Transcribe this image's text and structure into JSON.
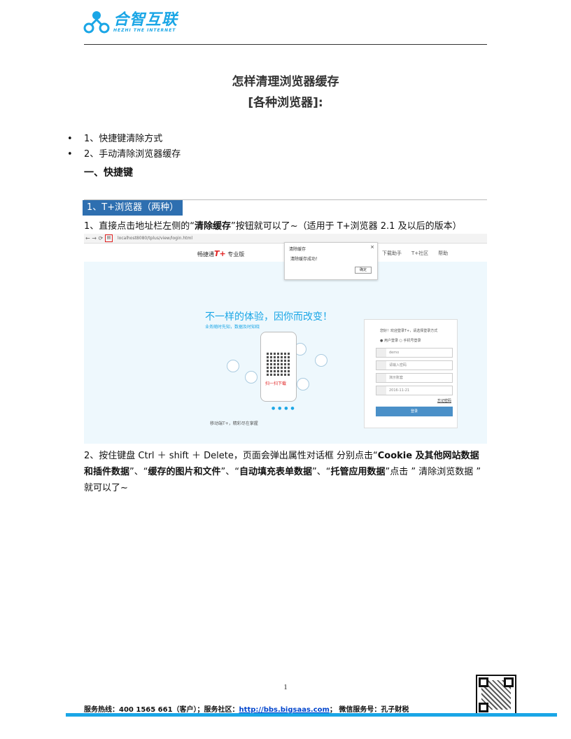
{
  "header": {
    "logo_cn": "合智互联",
    "logo_en": "HEZHI THE INTERNET"
  },
  "title": {
    "line1": "怎样清理浏览器缓存",
    "line2": "[各种浏览器]:"
  },
  "bullets": [
    "1、快捷键清除方式",
    "2、手动清除浏览器缓存"
  ],
  "section_heading": "一、快捷键",
  "subsection_tag": "1、T+浏览器（两种）",
  "para1": {
    "pre": "1、直接点击地址栏左侧的“",
    "bold": "清除缓存",
    "post": "”按钮就可以了~（适用于 T+浏览器 2.1 及以后的版本）"
  },
  "screenshot": {
    "url": "localhost8080/tplus/view/login.html",
    "brand": "畅捷通",
    "brand_tp": "T+",
    "brand_suffix": "专业版",
    "top_links": [
      "下载助手",
      "T+社区",
      "帮助"
    ],
    "dialog_title": "清除缓存",
    "dialog_msg": "清除缓存成功！",
    "dialog_ok": "确定",
    "slogan": "不一样的体验，因你而改变！",
    "slogan_sub": "业务随时先知，数据及时知晓",
    "phone_caption": "扫一扫下载",
    "bottom_text": "移动端T+，精彩尽在掌握",
    "login_question": "您好！欢迎登录T+，请选择登录方式",
    "login_radio": "● 用户登录    ○ 手机号登录",
    "login_fields": [
      "demo",
      "请输入密码",
      "演示账套",
      "2016-11-21"
    ],
    "login_forgot": "忘记密码",
    "login_button": "登录"
  },
  "para2": {
    "p1": "2、按住键盘 Ctrl ＋ shift ＋ Delete，页面会弹出属性对话框 分别点击“",
    "b1": "Cookie 及其他网站数据和插件数据",
    "p2": "”、“",
    "b2": "缓存的图片和文件",
    "p3": "”、“",
    "b3": "自动填充表单数据",
    "p4": "”、“",
    "b4": "托管应用数据",
    "p5": "”点击 ” 清除浏览数据 ” 就可以了~"
  },
  "page_number": "1",
  "footer": {
    "hotline": "服务热线：400 1565 661（客户）；服务社区：",
    "link": "http://bbs.bigsaas.com",
    "wechat": "；  微信服务号：孔子财税"
  }
}
